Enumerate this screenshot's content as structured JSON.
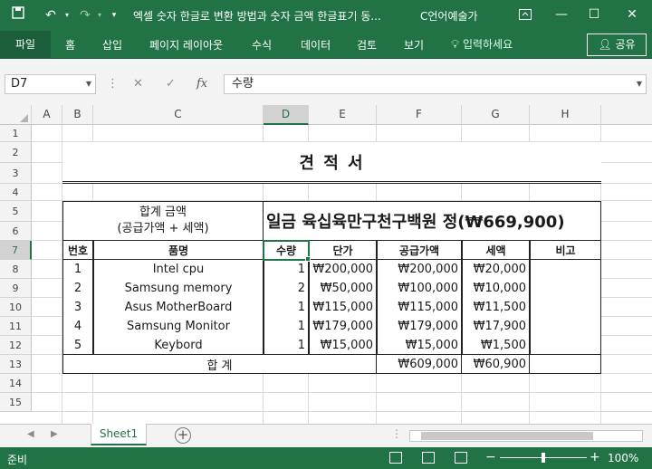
{
  "window": {
    "title": "엑셀 숫자 한글로 변환 방법과 숫자 금액 한글표기 동...",
    "user": "C언어예술가"
  },
  "ribbon": {
    "tabs": [
      "파일",
      "홈",
      "삽입",
      "페이지 레이아웃",
      "수식",
      "데이터",
      "검토",
      "보기"
    ],
    "tell_me": "입력하세요",
    "share": "공유"
  },
  "formula_bar": {
    "name_box": "D7",
    "fx": "fx",
    "value": "수량"
  },
  "columns": [
    "A",
    "B",
    "C",
    "D",
    "E",
    "F",
    "G",
    "H"
  ],
  "active_column": "D",
  "rows": [
    "1",
    "2",
    "3",
    "4",
    "5",
    "6",
    "7",
    "8",
    "9",
    "10",
    "11",
    "12",
    "13",
    "14",
    "15"
  ],
  "active_row": "7",
  "sheet": {
    "title": "견 적 서",
    "amount_label_line1": "합계 금액",
    "amount_label_line2": "(공급가액 + 세액)",
    "amount_text": "일금 육십육만구천구백원 정(₩669,900)",
    "headers": [
      "번호",
      "품명",
      "수량",
      "단가",
      "공급가액",
      "세액",
      "비고"
    ],
    "items": [
      [
        "1",
        "Intel cpu",
        "1",
        "₩200,000",
        "₩200,000",
        "₩20,000",
        ""
      ],
      [
        "2",
        "Samsung memory",
        "2",
        "₩50,000",
        "₩100,000",
        "₩10,000",
        ""
      ],
      [
        "3",
        "Asus MotherBoard",
        "1",
        "₩115,000",
        "₩115,000",
        "₩11,500",
        ""
      ],
      [
        "4",
        "Samsung Monitor",
        "1",
        "₩179,000",
        "₩179,000",
        "₩17,900",
        ""
      ],
      [
        "5",
        "Keybord",
        "1",
        "₩15,000",
        "₩15,000",
        "₩1,500",
        ""
      ]
    ],
    "total_label": "합   계",
    "total_supply": "₩609,000",
    "total_tax": "₩60,900"
  },
  "sheet_tabs": [
    "Sheet1"
  ],
  "status": {
    "ready": "준비",
    "zoom": "100%"
  },
  "colors": {
    "accent": "#217346"
  }
}
